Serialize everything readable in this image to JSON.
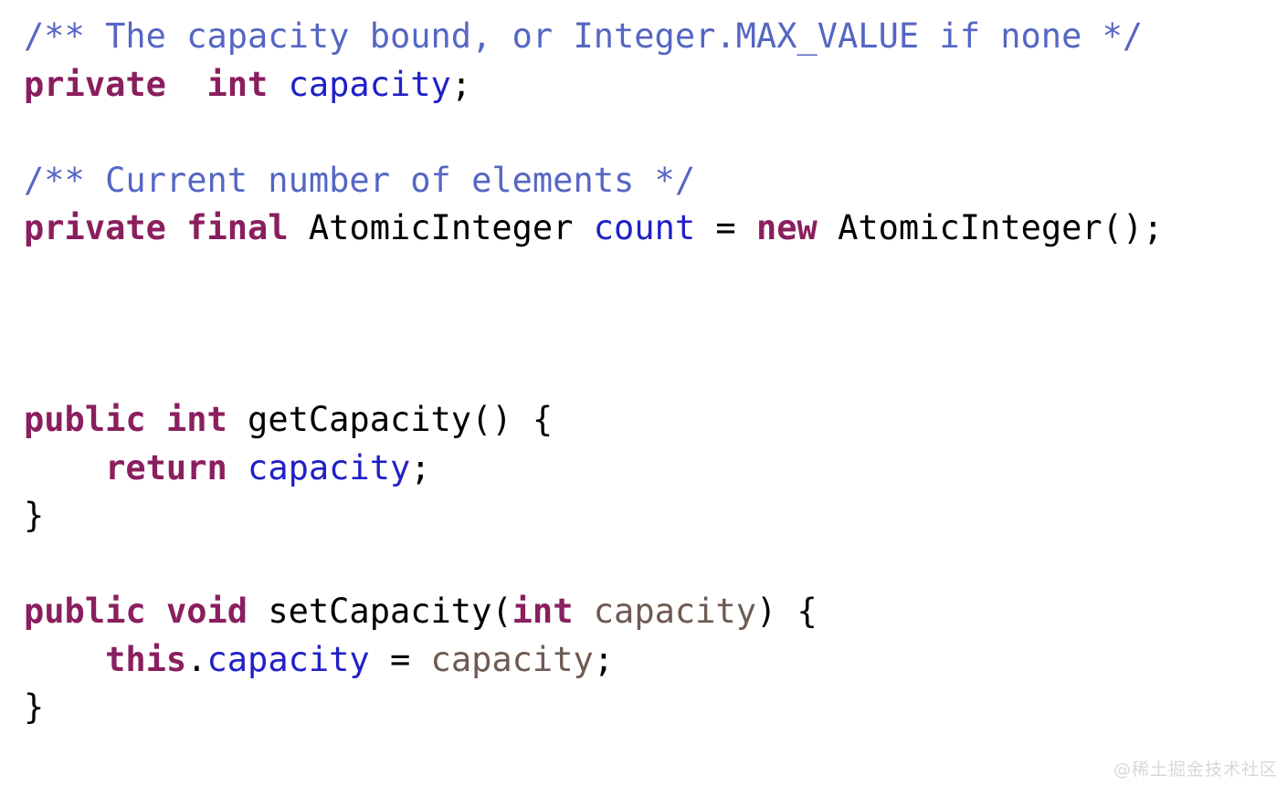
{
  "document": {
    "language": "java",
    "background_color": "#ffffff",
    "watermark": "@稀土掘金技术社区"
  },
  "theme": {
    "comment_color": "#5566c4",
    "keyword_color": "#8a1f5e",
    "field_color": "#2020c8",
    "plain_color": "#000000",
    "parameter_color": "#6e5a52",
    "background_color": "#ffffff",
    "watermark_color": "#d8d8d8"
  },
  "code": {
    "lines": [
      {
        "n": 1,
        "text": "/** The capacity bound, or Integer.MAX_VALUE if none */",
        "tokens": [
          {
            "t": "/** The capacity bound, or Integer.MAX_VALUE if none */",
            "c": "comment"
          }
        ]
      },
      {
        "n": 2,
        "text": "private  int capacity;",
        "tokens": [
          {
            "t": "private",
            "c": "keyword"
          },
          {
            "t": "  ",
            "c": "plain"
          },
          {
            "t": "int",
            "c": "keyword"
          },
          {
            "t": " ",
            "c": "plain"
          },
          {
            "t": "capacity",
            "c": "field"
          },
          {
            "t": ";",
            "c": "punct"
          }
        ]
      },
      {
        "n": 3,
        "text": "",
        "tokens": []
      },
      {
        "n": 4,
        "text": "/** Current number of elements */",
        "tokens": [
          {
            "t": "/** Current number of elements */",
            "c": "comment"
          }
        ]
      },
      {
        "n": 5,
        "text": "private final AtomicInteger count = new AtomicInteger();",
        "tokens": [
          {
            "t": "private",
            "c": "keyword"
          },
          {
            "t": " ",
            "c": "plain"
          },
          {
            "t": "final",
            "c": "keyword"
          },
          {
            "t": " ",
            "c": "plain"
          },
          {
            "t": "AtomicInteger",
            "c": "type"
          },
          {
            "t": " ",
            "c": "plain"
          },
          {
            "t": "count",
            "c": "field"
          },
          {
            "t": " = ",
            "c": "punct"
          },
          {
            "t": "new",
            "c": "keyword"
          },
          {
            "t": " ",
            "c": "plain"
          },
          {
            "t": "AtomicInteger();",
            "c": "type"
          }
        ]
      },
      {
        "n": 6,
        "text": "",
        "tokens": []
      },
      {
        "n": 7,
        "text": "",
        "tokens": []
      },
      {
        "n": 8,
        "text": "",
        "tokens": []
      },
      {
        "n": 9,
        "text": "public int getCapacity() {",
        "tokens": [
          {
            "t": "public",
            "c": "keyword"
          },
          {
            "t": " ",
            "c": "plain"
          },
          {
            "t": "int",
            "c": "keyword"
          },
          {
            "t": " ",
            "c": "plain"
          },
          {
            "t": "getCapacity",
            "c": "method"
          },
          {
            "t": "() {",
            "c": "punct"
          }
        ]
      },
      {
        "n": 10,
        "text": "    return capacity;",
        "tokens": [
          {
            "t": "    ",
            "c": "plain"
          },
          {
            "t": "return",
            "c": "keyword"
          },
          {
            "t": " ",
            "c": "plain"
          },
          {
            "t": "capacity",
            "c": "field"
          },
          {
            "t": ";",
            "c": "punct"
          }
        ]
      },
      {
        "n": 11,
        "text": "}",
        "tokens": [
          {
            "t": "}",
            "c": "punct"
          }
        ]
      },
      {
        "n": 12,
        "text": "",
        "tokens": []
      },
      {
        "n": 13,
        "text": "public void setCapacity(int capacity) {",
        "tokens": [
          {
            "t": "public",
            "c": "keyword"
          },
          {
            "t": " ",
            "c": "plain"
          },
          {
            "t": "void",
            "c": "keyword"
          },
          {
            "t": " ",
            "c": "plain"
          },
          {
            "t": "setCapacity",
            "c": "method"
          },
          {
            "t": "(",
            "c": "punct"
          },
          {
            "t": "int",
            "c": "keyword"
          },
          {
            "t": " ",
            "c": "plain"
          },
          {
            "t": "capacity",
            "c": "param"
          },
          {
            "t": ") {",
            "c": "punct"
          }
        ]
      },
      {
        "n": 14,
        "text": "    this.capacity = capacity;",
        "tokens": [
          {
            "t": "    ",
            "c": "plain"
          },
          {
            "t": "this",
            "c": "keyword"
          },
          {
            "t": ".",
            "c": "punct"
          },
          {
            "t": "capacity",
            "c": "field"
          },
          {
            "t": " = ",
            "c": "punct"
          },
          {
            "t": "capacity",
            "c": "param"
          },
          {
            "t": ";",
            "c": "punct"
          }
        ]
      },
      {
        "n": 15,
        "text": "}",
        "tokens": [
          {
            "t": "}",
            "c": "punct"
          }
        ]
      }
    ]
  }
}
